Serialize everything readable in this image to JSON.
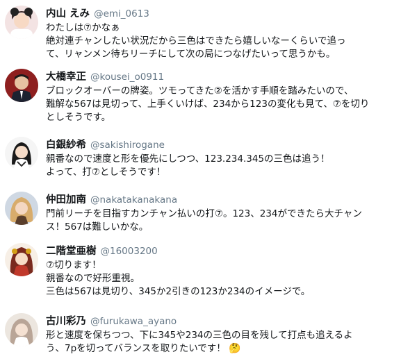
{
  "tweets": [
    {
      "name": "内山 えみ",
      "handle": "@emi_0613",
      "lines": [
        "わたしは⑦かなぁ",
        "絶対連チャンしたい状況だから三色はできたら嬉しいなーくらいで追っ",
        "て、リャンメン待ちリーチにして次の局につなげたいって思うかも。"
      ],
      "avatar_color": "#e8c8c8"
    },
    {
      "name": "大橋幸正",
      "handle": "@kousei_o0911",
      "lines": [
        "ブロックオーバーの牌姿。ツモってきた②を活かす手順を踏みたいので、",
        "難解な567は見切って、上手くいけば、234から123の変化も見て、⑦を切り",
        "としそうです。"
      ],
      "avatar_color": "#b03030"
    },
    {
      "name": "白銀紗希",
      "handle": "@sakishirogane",
      "lines": [
        "親番なので速度と形を優先にしつつ、123.234.345の三色は追う！",
        "よって、打⑦としそうです！"
      ],
      "avatar_color": "#f2f2f2"
    },
    {
      "name": "仲田加南",
      "handle": "@nakatakanakana",
      "lines": [
        "門前リーチを目指すカンチャン払いの打⑦。123、234ができたら大チャン",
        "ス！567は難しいかな。"
      ],
      "avatar_color": "#d9b27a"
    },
    {
      "name": "二階堂亜樹",
      "handle": "@16003200",
      "lines": [
        "⑦切ります！",
        "親番なので好形重視。",
        "三色は567は見切り、345か2引きの123か234のイメージで。"
      ],
      "avatar_color": "#c0392b"
    },
    {
      "name": "古川彩乃",
      "handle": "@furukawa_ayano",
      "lines": [
        "形と速度を保ちつつ、下に345や234の三色の目を残して打点も追えるよ",
        "う、7pを切ってバランスを取りたいです！"
      ],
      "emoji": "🤔",
      "avatar_color": "#e6dcd3"
    }
  ]
}
